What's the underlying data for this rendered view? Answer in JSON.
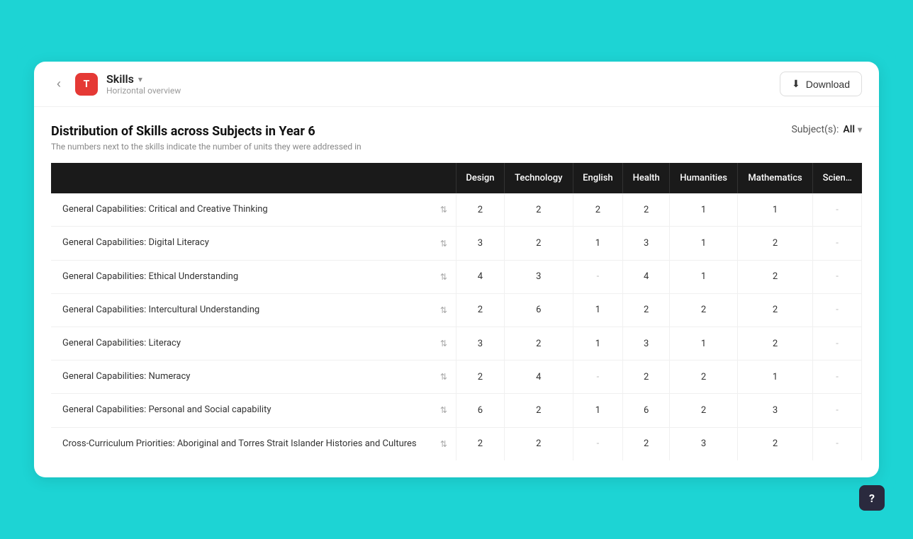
{
  "topbar": {
    "back_label": "‹",
    "app_icon_label": "T",
    "title": "Skills",
    "title_chevron": "▾",
    "subtitle": "Horizontal overview",
    "download_label": "Download",
    "download_icon": "⬇"
  },
  "section": {
    "title": "Distribution of Skills across Subjects in Year 6",
    "description": "The numbers next to the skills indicate the number of units they were addressed in",
    "filter_label": "Subject(s):",
    "filter_value": "All",
    "filter_chevron": "▾"
  },
  "table": {
    "headers": [
      "",
      "Design",
      "Technology",
      "English",
      "Health",
      "Humanities",
      "Mathematics",
      "Science"
    ],
    "rows": [
      {
        "skill": "General Capabilities: Critical and Creative Thinking",
        "values": [
          "2",
          "2",
          "2",
          "2",
          "1",
          "1",
          "-"
        ]
      },
      {
        "skill": "General Capabilities: Digital Literacy",
        "values": [
          "3",
          "2",
          "1",
          "3",
          "1",
          "2",
          "-"
        ]
      },
      {
        "skill": "General Capabilities: Ethical Understanding",
        "values": [
          "4",
          "3",
          "-",
          "4",
          "1",
          "2",
          "-"
        ]
      },
      {
        "skill": "General Capabilities: Intercultural Understanding",
        "values": [
          "2",
          "6",
          "1",
          "2",
          "2",
          "2",
          "-"
        ]
      },
      {
        "skill": "General Capabilities: Literacy",
        "values": [
          "3",
          "2",
          "1",
          "3",
          "1",
          "2",
          "-"
        ]
      },
      {
        "skill": "General Capabilities: Numeracy",
        "values": [
          "2",
          "4",
          "-",
          "2",
          "2",
          "1",
          "-"
        ]
      },
      {
        "skill": "General Capabilities: Personal and Social capability",
        "values": [
          "6",
          "2",
          "1",
          "6",
          "2",
          "3",
          "-"
        ]
      },
      {
        "skill": "Cross-Curriculum Priorities: Aboriginal and Torres Strait Islander Histories and Cultures",
        "values": [
          "2",
          "2",
          "-",
          "2",
          "3",
          "2",
          "-"
        ]
      }
    ]
  },
  "help_label": "?",
  "colors": {
    "accent": "#e53935",
    "bg_cyan": "#1dd4d4",
    "header_dark": "#1a1a1a"
  }
}
